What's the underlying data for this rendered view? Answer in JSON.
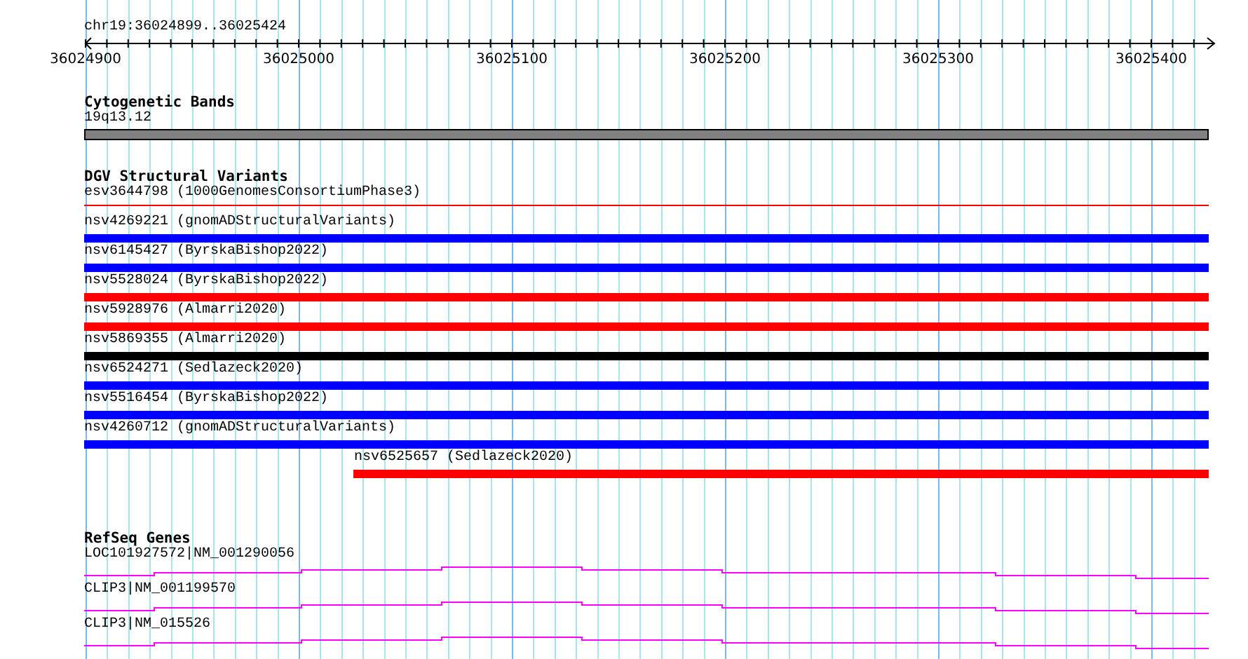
{
  "region": "chr19:36024899..36025424",
  "ruler": {
    "ticks": [
      "36024900",
      "36025000",
      "36025100",
      "36025200",
      "36025300",
      "36025400"
    ]
  },
  "cytogenetic_bands": {
    "title": "Cytogenetic Bands",
    "band": {
      "label": "19q13.12"
    }
  },
  "dgv_structural_variants": {
    "title": "DGV Structural Variants",
    "variants": [
      {
        "label": "esv3644798 (1000GenomesConsortiumPhase3)",
        "kind": "line",
        "color": "#ff0000",
        "level": 1
      },
      {
        "label": "nsv4269221 (gnomADStructuralVariants)",
        "kind": "bar",
        "color": "#0000ff",
        "level": 1
      },
      {
        "label": "nsv6145427 (ByrskaBishop2022)",
        "kind": "bar",
        "color": "#0000ff",
        "level": 1
      },
      {
        "label": "nsv5528024 (ByrskaBishop2022)",
        "kind": "bar",
        "color": "#ff0000",
        "level": 1
      },
      {
        "label": "nsv5928976 (Almarri2020)",
        "kind": "bar",
        "color": "#ff0000",
        "level": 1
      },
      {
        "label": "nsv5869355 (Almarri2020)",
        "kind": "bar",
        "color": "#000000",
        "level": 1
      },
      {
        "label": "nsv6524271 (Sedlazeck2020)",
        "kind": "bar",
        "color": "#0000ff",
        "level": 1
      },
      {
        "label": "nsv5516454 (ByrskaBishop2022)",
        "kind": "bar",
        "color": "#0000ff",
        "level": 1
      },
      {
        "label": "nsv4260712 (gnomADStructuralVariants)",
        "kind": "bar",
        "color": "#0000ff",
        "level": 1
      },
      {
        "label": "nsv6525657 (Sedlazeck2020)",
        "kind": "bar",
        "color": "#ff0000",
        "level": 0.76
      }
    ]
  },
  "refseq_genes": {
    "title": "RefSeq Genes",
    "genes": [
      {
        "label": "LOC101927572|NM_001290056"
      },
      {
        "label": "CLIP3|NM_001199570"
      },
      {
        "label": "CLIP3|NM_015526"
      }
    ]
  }
}
